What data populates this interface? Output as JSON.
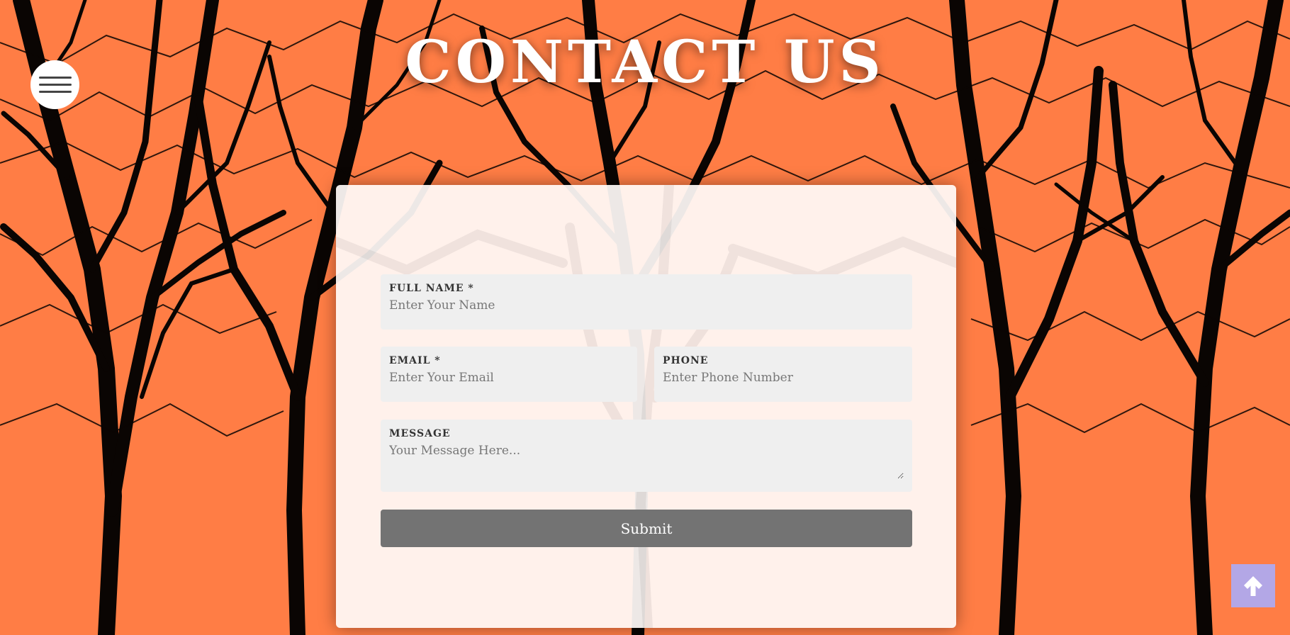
{
  "page": {
    "title": "CONTACT US",
    "background_color": "#ff7d45"
  },
  "nav": {
    "menu_icon": "hamburger-menu-icon"
  },
  "form": {
    "full_name": {
      "label": "FULL NAME *",
      "placeholder": "Enter Your Name",
      "value": ""
    },
    "email": {
      "label": "EMAIL *",
      "placeholder": "Enter Your Email",
      "value": ""
    },
    "phone": {
      "label": "PHONE",
      "placeholder": "Enter Phone Number",
      "value": ""
    },
    "message": {
      "label": "MESSAGE",
      "placeholder": "Your Message Here...",
      "value": ""
    },
    "submit_label": "Submit",
    "submit_color": "#737373"
  },
  "scroll_top": {
    "icon": "arrow-up-icon",
    "color": "#b3a7e6"
  }
}
